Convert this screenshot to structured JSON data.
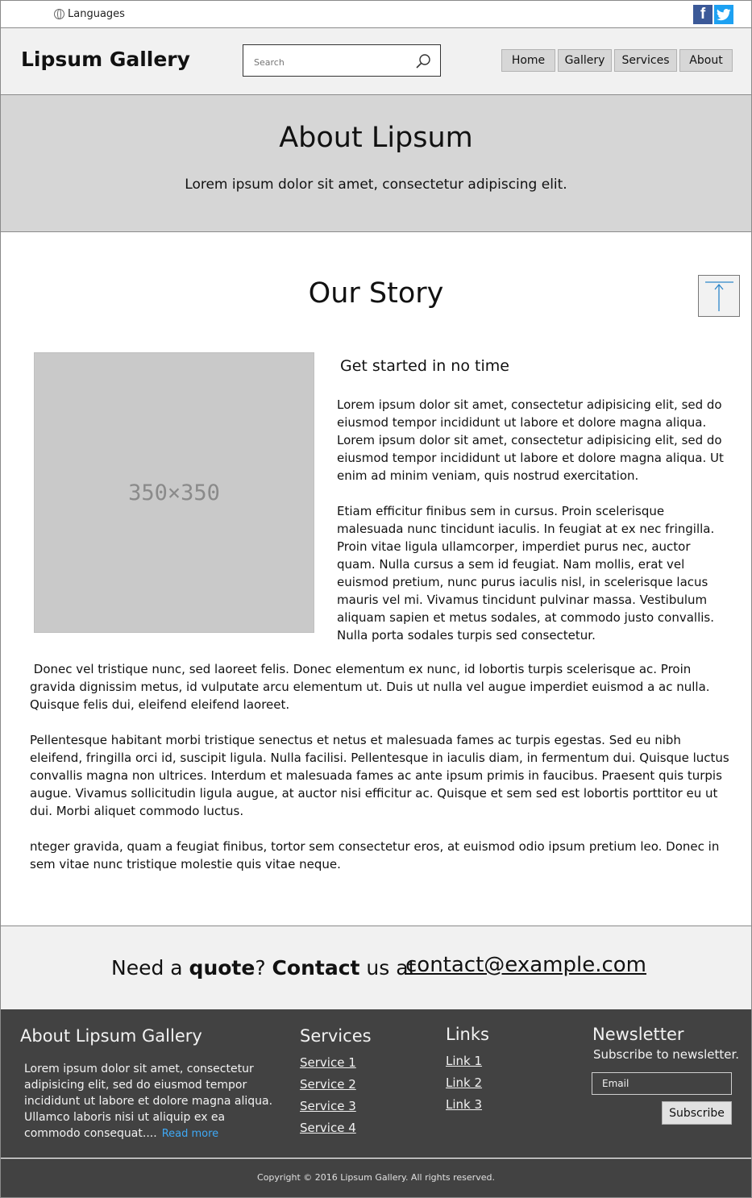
{
  "topbar": {
    "language_label": "Languages",
    "facebook_icon": "facebook-icon",
    "twitter_icon": "twitter-icon"
  },
  "header": {
    "brand": "Lipsum Gallery",
    "search_placeholder": "Search",
    "nav": [
      "Home",
      "Gallery",
      "Services",
      "About"
    ]
  },
  "hero": {
    "title": "About Lipsum",
    "subtitle": "Lorem ipsum dolor sit amet, consectetur adipiscing elit."
  },
  "story": {
    "title": "Our Story",
    "image_label": "350×350",
    "subheading": "Get started in no time",
    "side_paragraphs": [
      "Lorem ipsum dolor sit amet, consectetur adipisicing elit, sed do eiusmod tempor incididunt ut labore et dolore magna aliqua. Lorem ipsum dolor sit amet, consectetur adipisicing elit, sed do eiusmod tempor incididunt ut labore et dolore magna aliqua. Ut enim ad minim veniam, quis nostrud exercitation.",
      "Etiam efficitur finibus sem in cursus. Proin scelerisque malesuada nunc tincidunt iaculis. In feugiat at ex nec fringilla. Proin vitae ligula ullamcorper, imperdiet purus nec, auctor quam. Nulla cursus a sem id feugiat. Nam mollis, erat vel euismod pretium, nunc purus iaculis nisl, in scelerisque lacus mauris vel mi. Vivamus tincidunt pulvinar massa. Vestibulum aliquam sapien et metus sodales, at commodo justo convallis. Nulla porta sodales turpis sed consectetur."
    ],
    "body_paragraphs": [
      " Donec vel tristique nunc, sed laoreet felis. Donec elementum ex nunc, id lobortis turpis scelerisque ac. Proin gravida dignissim metus, id vulputate arcu elementum ut. Duis ut nulla vel augue imperdiet euismod a ac nulla. Quisque felis dui, eleifend eleifend laoreet.",
      "Pellentesque habitant morbi tristique senectus et netus et malesuada fames ac turpis egestas. Sed eu nibh eleifend, fringilla orci id, suscipit ligula. Nulla facilisi. Pellentesque in iaculis diam, in fermentum dui. Quisque luctus convallis magna non ultrices. Interdum et malesuada fames ac ante ipsum primis in faucibus. Praesent quis turpis augue. Vivamus sollicitudin ligula augue, at auctor nisi efficitur ac. Quisque et sem sed est lobortis porttitor eu ut dui. Morbi aliquet commodo luctus.",
      "nteger gravida, quam a feugiat finibus, tortor sem consectetur eros, at euismod odio ipsum pretium leo. Donec in sem vitae nunc tristique molestie quis vitae neque."
    ]
  },
  "cta": {
    "need": "Need a ",
    "quote": "quote",
    "q_mark": "? ",
    "contact": "Contact",
    "us_at": " us at",
    "email": "contact@example.com"
  },
  "footer": {
    "about_title": "About Lipsum Gallery",
    "about_text": "Lorem ipsum dolor sit amet, consectetur adipisicing elit, sed do eiusmod tempor incididunt ut labore et dolore magna aliqua. Ullamco laboris nisi ut aliquip ex ea commodo consequat....",
    "read_more": "Read more",
    "services_title": "Services",
    "services": [
      "Service 1",
      "Service 2",
      "Service 3",
      "Service 4"
    ],
    "links_title": "Links",
    "links": [
      "Link 1",
      "Link 2",
      "Link 3"
    ],
    "newsletter_title": "Newsletter",
    "newsletter_sub": "Subscribe to newsletter.",
    "email_placeholder": "Email",
    "subscribe": "Subscribe",
    "copyright": "Copyright © 2016 Lipsum Gallery. All rights reserved."
  }
}
